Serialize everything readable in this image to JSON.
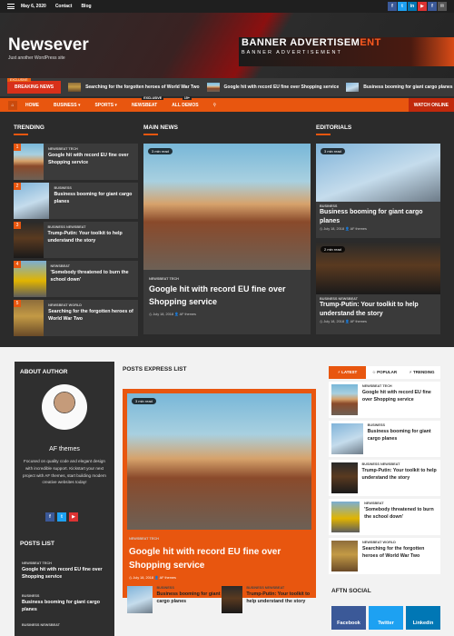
{
  "topbar": {
    "date": "May 6, 2020",
    "links": [
      "Contact",
      "Blog"
    ],
    "socials": [
      "f",
      "t",
      "in",
      "▶",
      "f",
      "✉"
    ]
  },
  "header": {
    "title": "Newsever",
    "tagline": "Just another WordPress site",
    "ad_line1a": "BANNER ADVERTISEM",
    "ad_line1b": "ENT",
    "ad_line2": "BANNER ADVERTISEMENT"
  },
  "breaking": {
    "exclusive": "EXCLUSIVE",
    "label": "BREAKING NEWS",
    "items": [
      "Searching for the forgotten heroes of World War Two",
      "Google hit with record EU fine over Shopping service",
      "Business booming for giant cargo planes"
    ]
  },
  "nav": {
    "items": [
      "HOME",
      "BUSINESS ▾",
      "SPORTS ▾",
      "NEWSBEAT",
      "ALL DEMOS"
    ],
    "badges": [
      "EXCLUSIVE",
      "15+"
    ],
    "watch": "WATCH ONLINE"
  },
  "trending": {
    "title": "TRENDING",
    "items": [
      {
        "num": "1",
        "cat": "NEWSBEAT  TECH",
        "title": "Google hit with record EU fine over Shopping service"
      },
      {
        "num": "2",
        "cat": "BUSINESS",
        "title": "Business booming for giant cargo planes"
      },
      {
        "num": "3",
        "cat": "BUSINESS  NEWSBEAT",
        "title": "Trump-Putin: Your toolkit to help understand the story"
      },
      {
        "num": "4",
        "cat": "NEWSBEAT",
        "title": "'Somebody threatened to burn the school down'"
      },
      {
        "num": "5",
        "cat": "NEWSBEAT  WORLD",
        "title": "Searching for the forgotten heroes of World War Two"
      }
    ]
  },
  "main_news": {
    "title": "MAIN NEWS",
    "read": "3 min read",
    "cat": "NEWSBEAT  TECH",
    "headline": "Google hit with record EU fine over Shopping service",
    "meta": "◷ July 18, 2018   👤 AF themes"
  },
  "editorials": {
    "title": "EDITORIALS",
    "items": [
      {
        "read": "3 min read",
        "cat": "BUSINESS",
        "title": "Business booming for giant cargo planes",
        "meta": "◷ July 18, 2018   👤 AF themes"
      },
      {
        "read": "2 min read",
        "cat": "BUSINESS  NEWSBEAT",
        "title": "Trump-Putin: Your toolkit to help understand the story",
        "meta": "◷ July 18, 2018   👤 AF themes"
      }
    ]
  },
  "about": {
    "title": "ABOUT AUTHOR",
    "name": "AF themes",
    "bio": "Focused on quality code and elegant design with incredible support. Kickstart your next project with AF themes, start building modern creative websites today!",
    "socials": [
      "f",
      "t",
      "▶"
    ]
  },
  "posts_list": {
    "title": "POSTS LIST",
    "items": [
      {
        "cat": "NEWSBEAT  TECH",
        "title": "Google hit with record EU fine over Shopping service"
      },
      {
        "cat": "BUSINESS",
        "title": "Business booming for giant cargo planes"
      },
      {
        "cat": "BUSINESS  NEWSBEAT",
        "title": ""
      }
    ]
  },
  "posts_express": {
    "title": "POSTS EXPRESS LIST",
    "read": "3 min read",
    "cat": "NEWSBEAT  TECH",
    "headline": "Google hit with record EU fine over Shopping service",
    "meta": "◷ July 18, 2018   👤 AF themes",
    "small": [
      {
        "cat": "BUSINESS",
        "title": "Business booming for giant cargo planes"
      },
      {
        "cat": "BUSINESS  NEWSBEAT",
        "title": "Trump-Putin: Your toolkit to help understand the story"
      }
    ]
  },
  "right_tabs": {
    "tabs": [
      "⚡ LATEST",
      "☆ POPULAR",
      "⚡ TRENDING"
    ],
    "items": [
      {
        "cat": "NEWSBEAT  TECH",
        "title": "Google hit with record EU fine over Shopping service"
      },
      {
        "cat": "BUSINESS",
        "title": "Business booming for giant cargo planes"
      },
      {
        "cat": "BUSINESS  NEWSBEAT",
        "title": "Trump-Putin: Your toolkit to help understand the story"
      },
      {
        "cat": "NEWSBEAT",
        "title": "'Somebody threatened to burn the school down'"
      },
      {
        "cat": "NEWSBEAT  WORLD",
        "title": "Searching for the forgotten heroes of World War Two"
      }
    ]
  },
  "aftn_social": {
    "title": "AFTN SOCIAL",
    "buttons": [
      "Facebook",
      "Twitter",
      "Linkedin"
    ]
  },
  "colors": {
    "accent": "#e8560f",
    "dark": "#2b2b2b",
    "facebook": "#3b5998",
    "twitter": "#1da1f2",
    "linkedin": "#0077b5"
  }
}
